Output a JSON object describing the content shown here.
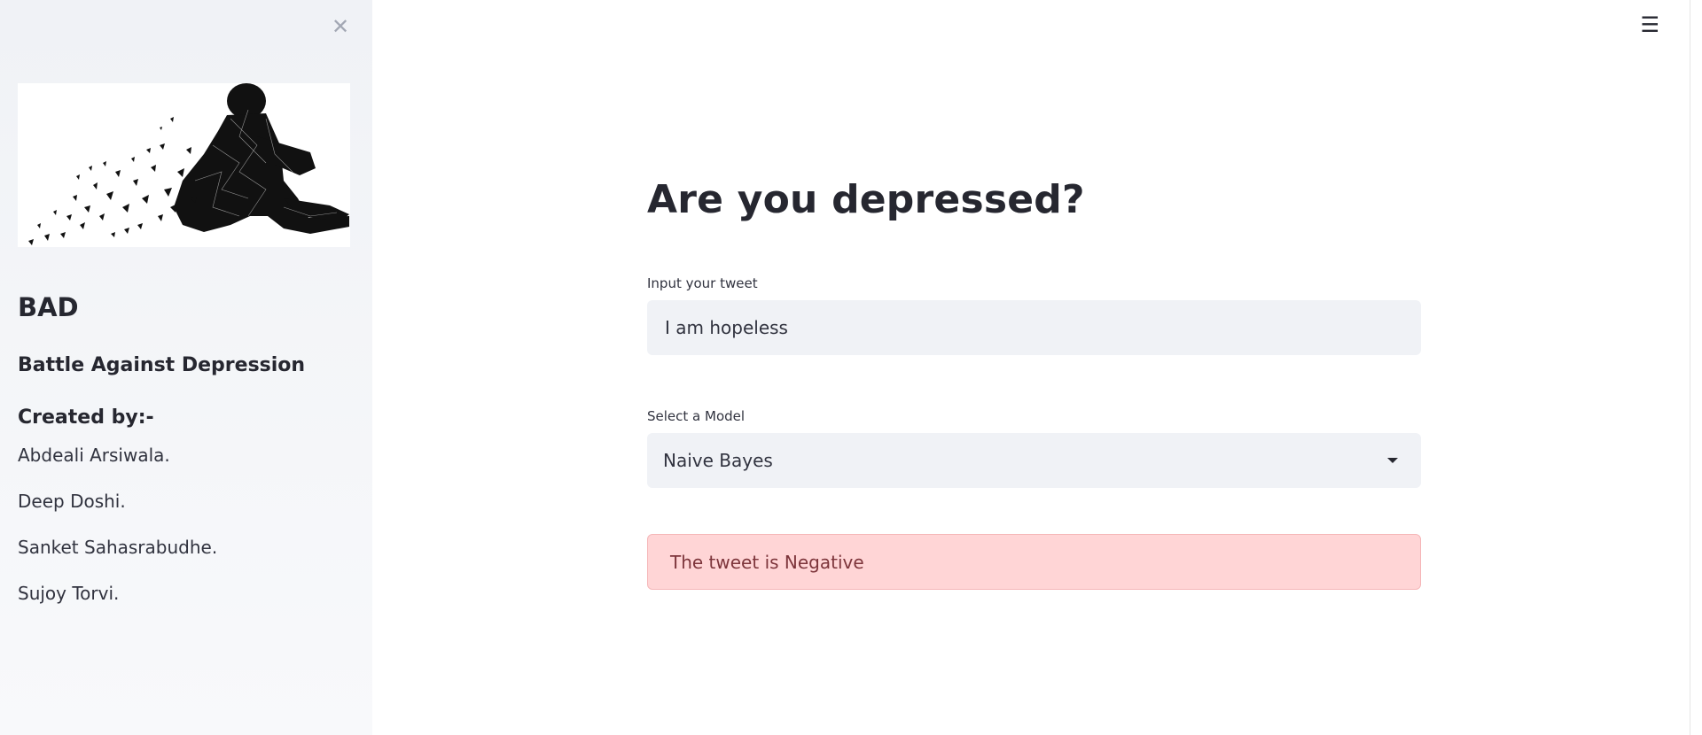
{
  "sidebar": {
    "close_glyph": "✕",
    "image_icon": "shattering-person-image",
    "title": "BAD",
    "subtitle": "Battle Against Depression",
    "created_label": "Created by:-",
    "authors": [
      "Abdeali Arsiwala.",
      "Deep Doshi.",
      "Sanket Sahasrabudhe.",
      "Sujoy Torvi."
    ]
  },
  "header": {
    "menu_glyph": "☰"
  },
  "main": {
    "title": "Are you depressed?",
    "tweet_input": {
      "label": "Input your tweet",
      "value": "I am hopeless"
    },
    "model_select": {
      "label": "Select a Model",
      "value": "Naive Bayes"
    },
    "result": {
      "text": "The tweet is Negative",
      "status": "error"
    }
  },
  "colors": {
    "sidebar_bg": "#f0f2f6",
    "input_bg": "#f0f2f6",
    "alert_bg": "#ffd5d6",
    "alert_text": "#7d353b",
    "text": "#262730"
  }
}
